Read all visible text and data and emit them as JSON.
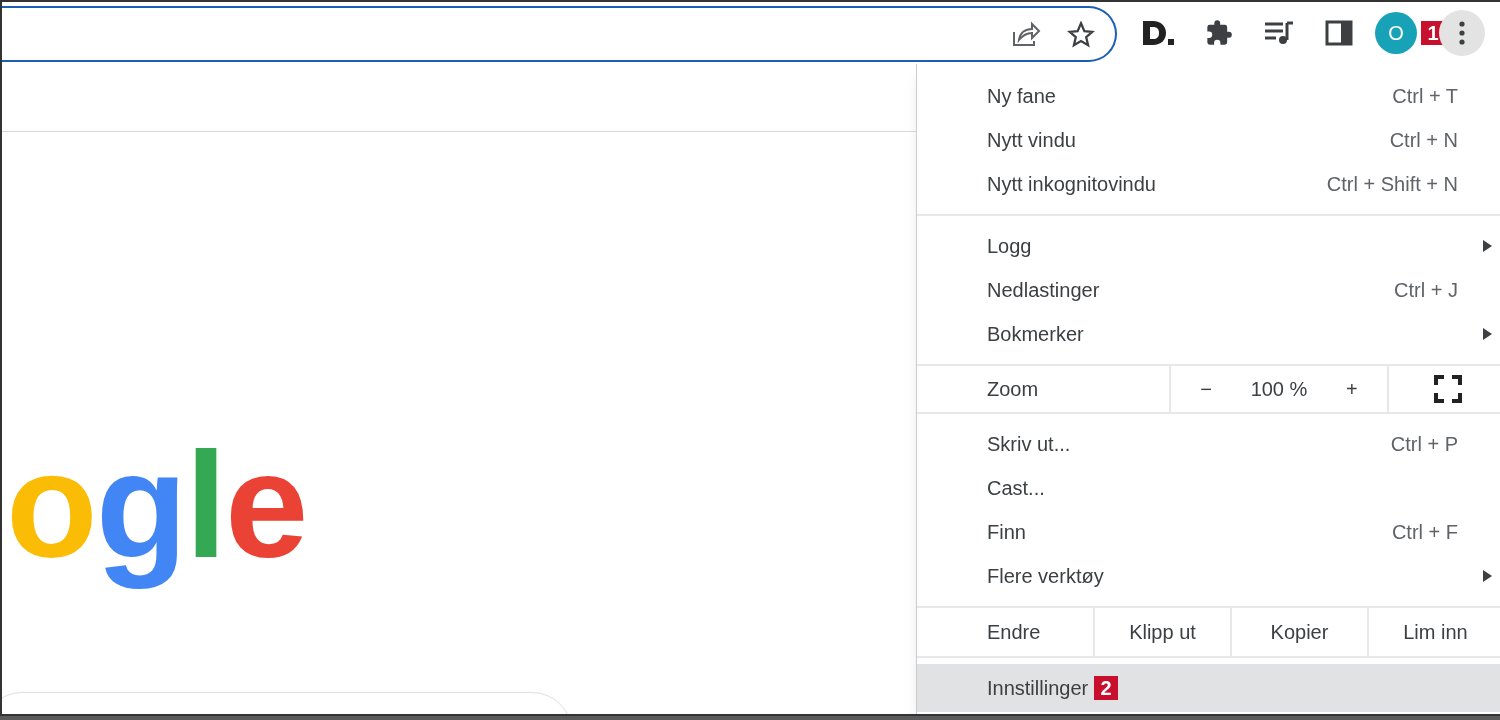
{
  "toolbar": {
    "avatar": "O",
    "menu_badge": "1"
  },
  "logo_letters": [
    {
      "text": "o",
      "color": "#fbbc05"
    },
    {
      "text": "g",
      "color": "#4285f4"
    },
    {
      "text": "l",
      "color": "#34a853"
    },
    {
      "text": "e",
      "color": "#ea4335"
    }
  ],
  "menu": {
    "sections": [
      {
        "items": [
          {
            "kind": "item",
            "label": "Ny fane",
            "shortcut": "Ctrl + T",
            "submenu": false,
            "selected": false
          },
          {
            "kind": "item",
            "label": "Nytt vindu",
            "shortcut": "Ctrl + N",
            "submenu": false,
            "selected": false
          },
          {
            "kind": "item",
            "label": "Nytt inkognitovindu",
            "shortcut": "Ctrl + Shift + N",
            "submenu": false,
            "selected": false
          }
        ]
      },
      {
        "items": [
          {
            "kind": "item",
            "label": "Logg",
            "submenu": true,
            "selected": false
          },
          {
            "kind": "item",
            "label": "Nedlastinger",
            "shortcut": "Ctrl + J",
            "submenu": false,
            "selected": false
          },
          {
            "kind": "item",
            "label": "Bokmerker",
            "submenu": true,
            "selected": false
          }
        ]
      },
      {
        "items": [
          {
            "kind": "zoom",
            "label": "Zoom",
            "minus": "−",
            "value": "100 %",
            "plus": "+"
          }
        ]
      },
      {
        "items": [
          {
            "kind": "item",
            "label": "Skriv ut...",
            "shortcut": "Ctrl + P",
            "submenu": false,
            "selected": false
          },
          {
            "kind": "item",
            "label": "Cast...",
            "submenu": false,
            "selected": false
          },
          {
            "kind": "item",
            "label": "Finn",
            "shortcut": "Ctrl + F",
            "submenu": false,
            "selected": false
          },
          {
            "kind": "item",
            "label": "Flere verktøy",
            "submenu": true,
            "selected": false
          }
        ]
      },
      {
        "items": [
          {
            "kind": "edit",
            "label": "Endre",
            "buttons": [
              "Klipp ut",
              "Kopier",
              "Lim inn"
            ]
          }
        ]
      },
      {
        "items": [
          {
            "kind": "item",
            "label": "Innstillinger",
            "badge": "2",
            "submenu": false,
            "selected": true
          }
        ]
      }
    ]
  }
}
